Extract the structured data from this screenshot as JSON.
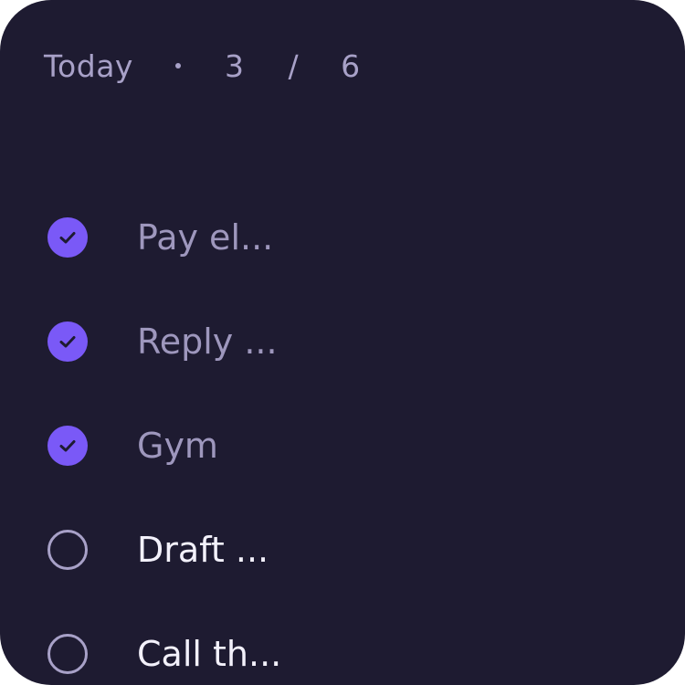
{
  "header": {
    "title": "Today",
    "separator": "·",
    "done_count": "3",
    "slash": "/",
    "total_count": "6"
  },
  "tasks": [
    {
      "label": "Pay el...",
      "completed": true
    },
    {
      "label": "Reply ...",
      "completed": true
    },
    {
      "label": "Gym",
      "completed": true
    },
    {
      "label": "Draft ...",
      "completed": false
    },
    {
      "label": "Call th...",
      "completed": false
    }
  ],
  "colors": {
    "background": "#1e1b31",
    "accent": "#7a59f7",
    "muted_text": "#a8a1c8",
    "active_text": "#f3f1fb"
  },
  "icons": {
    "checked": "check-circle-filled-icon",
    "unchecked": "circle-outline-icon"
  }
}
